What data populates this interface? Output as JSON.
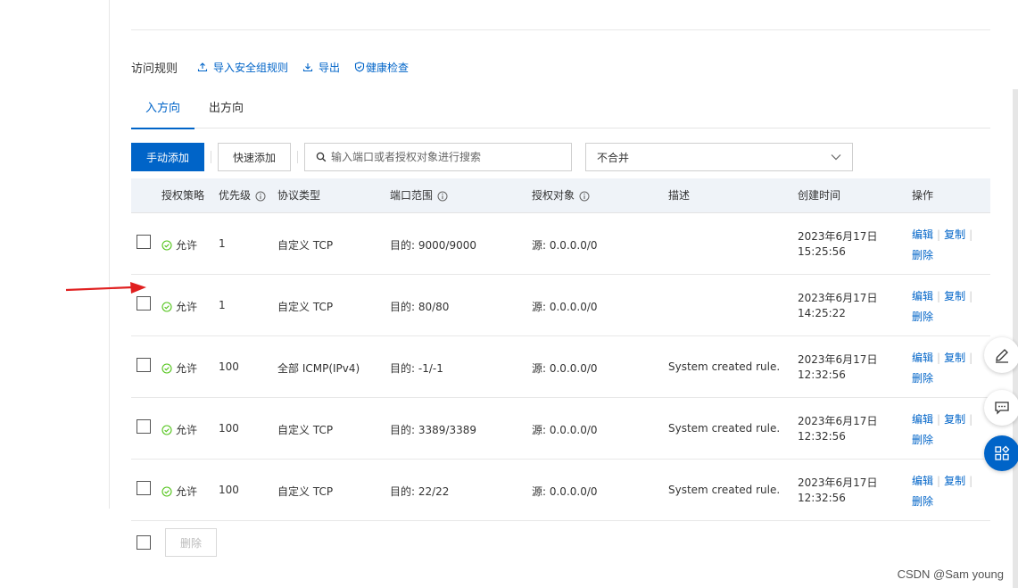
{
  "section": {
    "title": "访问规则",
    "links": {
      "import": "导入安全组规则",
      "export": "导出",
      "health": "健康检查"
    }
  },
  "tabs": [
    {
      "label": "入方向",
      "active": true
    },
    {
      "label": "出方向",
      "active": false
    }
  ],
  "toolbar": {
    "manual_add": "手动添加",
    "quick_add": "快速添加",
    "search_placeholder": "输入端口或者授权对象进行搜索",
    "merge_select": "不合并"
  },
  "table": {
    "columns": {
      "policy": "授权策略",
      "priority": "优先级",
      "protocol": "协议类型",
      "port": "端口范围",
      "object": "授权对象",
      "desc": "描述",
      "created": "创建时间",
      "ops": "操作"
    },
    "rows": [
      {
        "policy": "允许",
        "priority": "1",
        "protocol": "自定义 TCP",
        "port": "目的: 9000/9000",
        "object": "源: 0.0.0.0/0",
        "desc": "",
        "date": "2023年6月17日",
        "time": "15:25:56"
      },
      {
        "policy": "允许",
        "priority": "1",
        "protocol": "自定义 TCP",
        "port": "目的: 80/80",
        "object": "源: 0.0.0.0/0",
        "desc": "",
        "date": "2023年6月17日",
        "time": "14:25:22"
      },
      {
        "policy": "允许",
        "priority": "100",
        "protocol": "全部 ICMP(IPv4)",
        "port": "目的: -1/-1",
        "object": "源: 0.0.0.0/0",
        "desc": "System created rule.",
        "date": "2023年6月17日",
        "time": "12:32:56"
      },
      {
        "policy": "允许",
        "priority": "100",
        "protocol": "自定义 TCP",
        "port": "目的: 3389/3389",
        "object": "源: 0.0.0.0/0",
        "desc": "System created rule.",
        "date": "2023年6月17日",
        "time": "12:32:56"
      },
      {
        "policy": "允许",
        "priority": "100",
        "protocol": "自定义 TCP",
        "port": "目的: 22/22",
        "object": "源: 0.0.0.0/0",
        "desc": "System created rule.",
        "date": "2023年6月17日",
        "time": "12:32:56"
      }
    ],
    "op_labels": {
      "edit": "编辑",
      "copy": "复制",
      "delete": "删除"
    }
  },
  "bulk": {
    "delete_label": "删除"
  },
  "watermark": "CSDN @Sam young",
  "colors": {
    "accent": "#0064c8",
    "success": "#52c41a",
    "annotation_arrow": "#e02020"
  }
}
